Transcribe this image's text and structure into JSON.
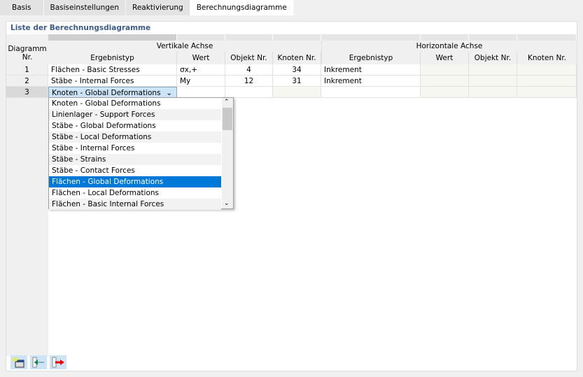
{
  "tabs": [
    {
      "label": "Basis"
    },
    {
      "label": "Basiseinstellungen"
    },
    {
      "label": "Reaktivierung"
    },
    {
      "label": "Berechnungsdiagramme",
      "active": true
    }
  ],
  "panel": {
    "title": "Liste der Berechnungsdiagramme"
  },
  "table": {
    "col_diagram": "Diagramm",
    "col_nr": "Nr.",
    "group_vertical": "Vertikale Achse",
    "group_horizontal": "Horizontale Achse",
    "v_cols": [
      "Ergebnistyp",
      "Wert",
      "Objekt Nr.",
      "Knoten Nr."
    ],
    "h_cols": [
      "Ergebnistyp",
      "Wert",
      "Objekt Nr.",
      "Knoten Nr."
    ],
    "rows": [
      {
        "nr": "1",
        "v_type": "Flächen - Basic Stresses",
        "v_value": "σx,+",
        "v_obj": "4",
        "v_node": "34",
        "h_type": "Inkrement",
        "h_value": "",
        "h_obj": "",
        "h_node": ""
      },
      {
        "nr": "2",
        "v_type": "Stäbe - Internal Forces",
        "v_value": "My",
        "v_obj": "12",
        "v_node": "31",
        "h_type": "Inkrement",
        "h_value": "",
        "h_obj": "",
        "h_node": ""
      },
      {
        "nr": "3",
        "v_type": "Knoten - Global Deformations",
        "v_value": "",
        "v_obj": "",
        "v_node": "",
        "h_type": "",
        "h_value": "",
        "h_obj": "",
        "h_node": ""
      }
    ]
  },
  "dropdown": {
    "selected": "Knoten - Global Deformations",
    "options": [
      "Knoten - Global Deformations",
      "Linienlager - Support Forces",
      "Stäbe - Global Deformations",
      "Stäbe - Local Deformations",
      "Stäbe - Internal Forces",
      "Stäbe - Strains",
      "Stäbe - Contact Forces",
      "Flächen - Global Deformations",
      "Flächen - Local Deformations",
      "Flächen - Basic Internal Forces"
    ],
    "highlighted_index": 7
  },
  "toolbar": {
    "buttons": [
      {
        "icon": "new-diagram-icon"
      },
      {
        "icon": "import-icon"
      },
      {
        "icon": "export-icon"
      }
    ]
  },
  "colors": {
    "accent": "#0078d7",
    "title": "#3c5a8a"
  }
}
